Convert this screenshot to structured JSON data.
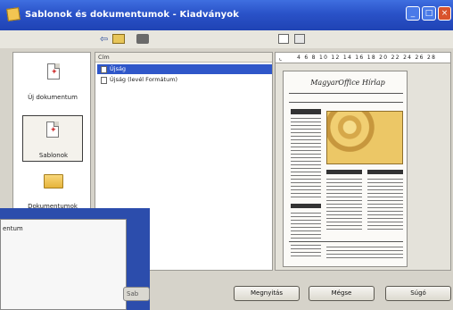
{
  "window": {
    "title": "Sablonok és dokumentumok - Kiadványok",
    "controls": [
      "minimize",
      "maximize",
      "close"
    ]
  },
  "toolbar": {
    "icons": [
      "back-icon",
      "folder-up-icon",
      "print-icon",
      "view-list-icon",
      "view-details-icon"
    ]
  },
  "sidebar": {
    "items": [
      {
        "label": "Új dokumentum",
        "icon": "new-document-icon"
      },
      {
        "label": "Sablonok",
        "icon": "templates-icon",
        "selected": true
      },
      {
        "label": "Dokumentumok",
        "icon": "documents-folder-icon"
      }
    ]
  },
  "list": {
    "header": "Cím",
    "rows": [
      {
        "label": "Újság",
        "selected": true
      },
      {
        "label": "Újság (levél Formátum)",
        "selected": false
      }
    ]
  },
  "preview": {
    "ruler_ticks": "4 6 8 10 12 14 16 18 20 22 24 26 28",
    "masthead": "MagyarOffice Hírlap"
  },
  "overlay": {
    "text": "entum",
    "button_label": "Sab"
  },
  "buttons": {
    "open": "Megnyitás",
    "cancel": "Mégse",
    "help": "Súgó"
  }
}
